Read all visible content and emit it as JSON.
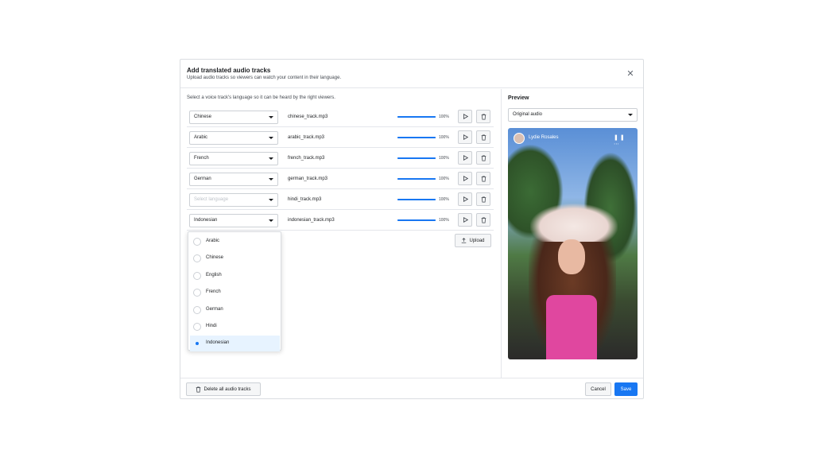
{
  "dialog": {
    "title": "Add translated audio tracks",
    "subtitle": "Upload audio tracks so viewers can watch your content in their language."
  },
  "instructions": "Select a voice track's language so it can be heard by the right viewers.",
  "tracks": [
    {
      "language": "Chinese",
      "file": "chinese_track.mp3",
      "volume": "100%",
      "volume_fraction": 1.0
    },
    {
      "language": "Arabic",
      "file": "arabic_track.mp3",
      "volume": "100%",
      "volume_fraction": 1.0
    },
    {
      "language": "French",
      "file": "french_track.mp3",
      "volume": "100%",
      "volume_fraction": 1.0
    },
    {
      "language": "German",
      "file": "german_track.mp3",
      "volume": "100%",
      "volume_fraction": 1.0
    },
    {
      "language": "Select language",
      "file": "hindi_track.mp3",
      "volume": "100%",
      "volume_fraction": 1.0
    },
    {
      "language": "Indonesian",
      "file": "indonesian_track.mp3",
      "volume": "100%",
      "volume_fraction": 1.0
    }
  ],
  "upload_label": "Upload",
  "dropdown": {
    "options": [
      "Arabic",
      "Chinese",
      "English",
      "French",
      "German",
      "Hindi",
      "Indonesian"
    ],
    "selected": "Indonesian"
  },
  "preview": {
    "title": "Preview",
    "audio_select": "Original audio",
    "creator_name": "Lydie Rosales"
  },
  "footer": {
    "delete_all": "Delete all audio tracks",
    "cancel": "Cancel",
    "save": "Save"
  },
  "colors": {
    "accent": "#1877f2",
    "selected_bg": "#e7f3ff"
  }
}
